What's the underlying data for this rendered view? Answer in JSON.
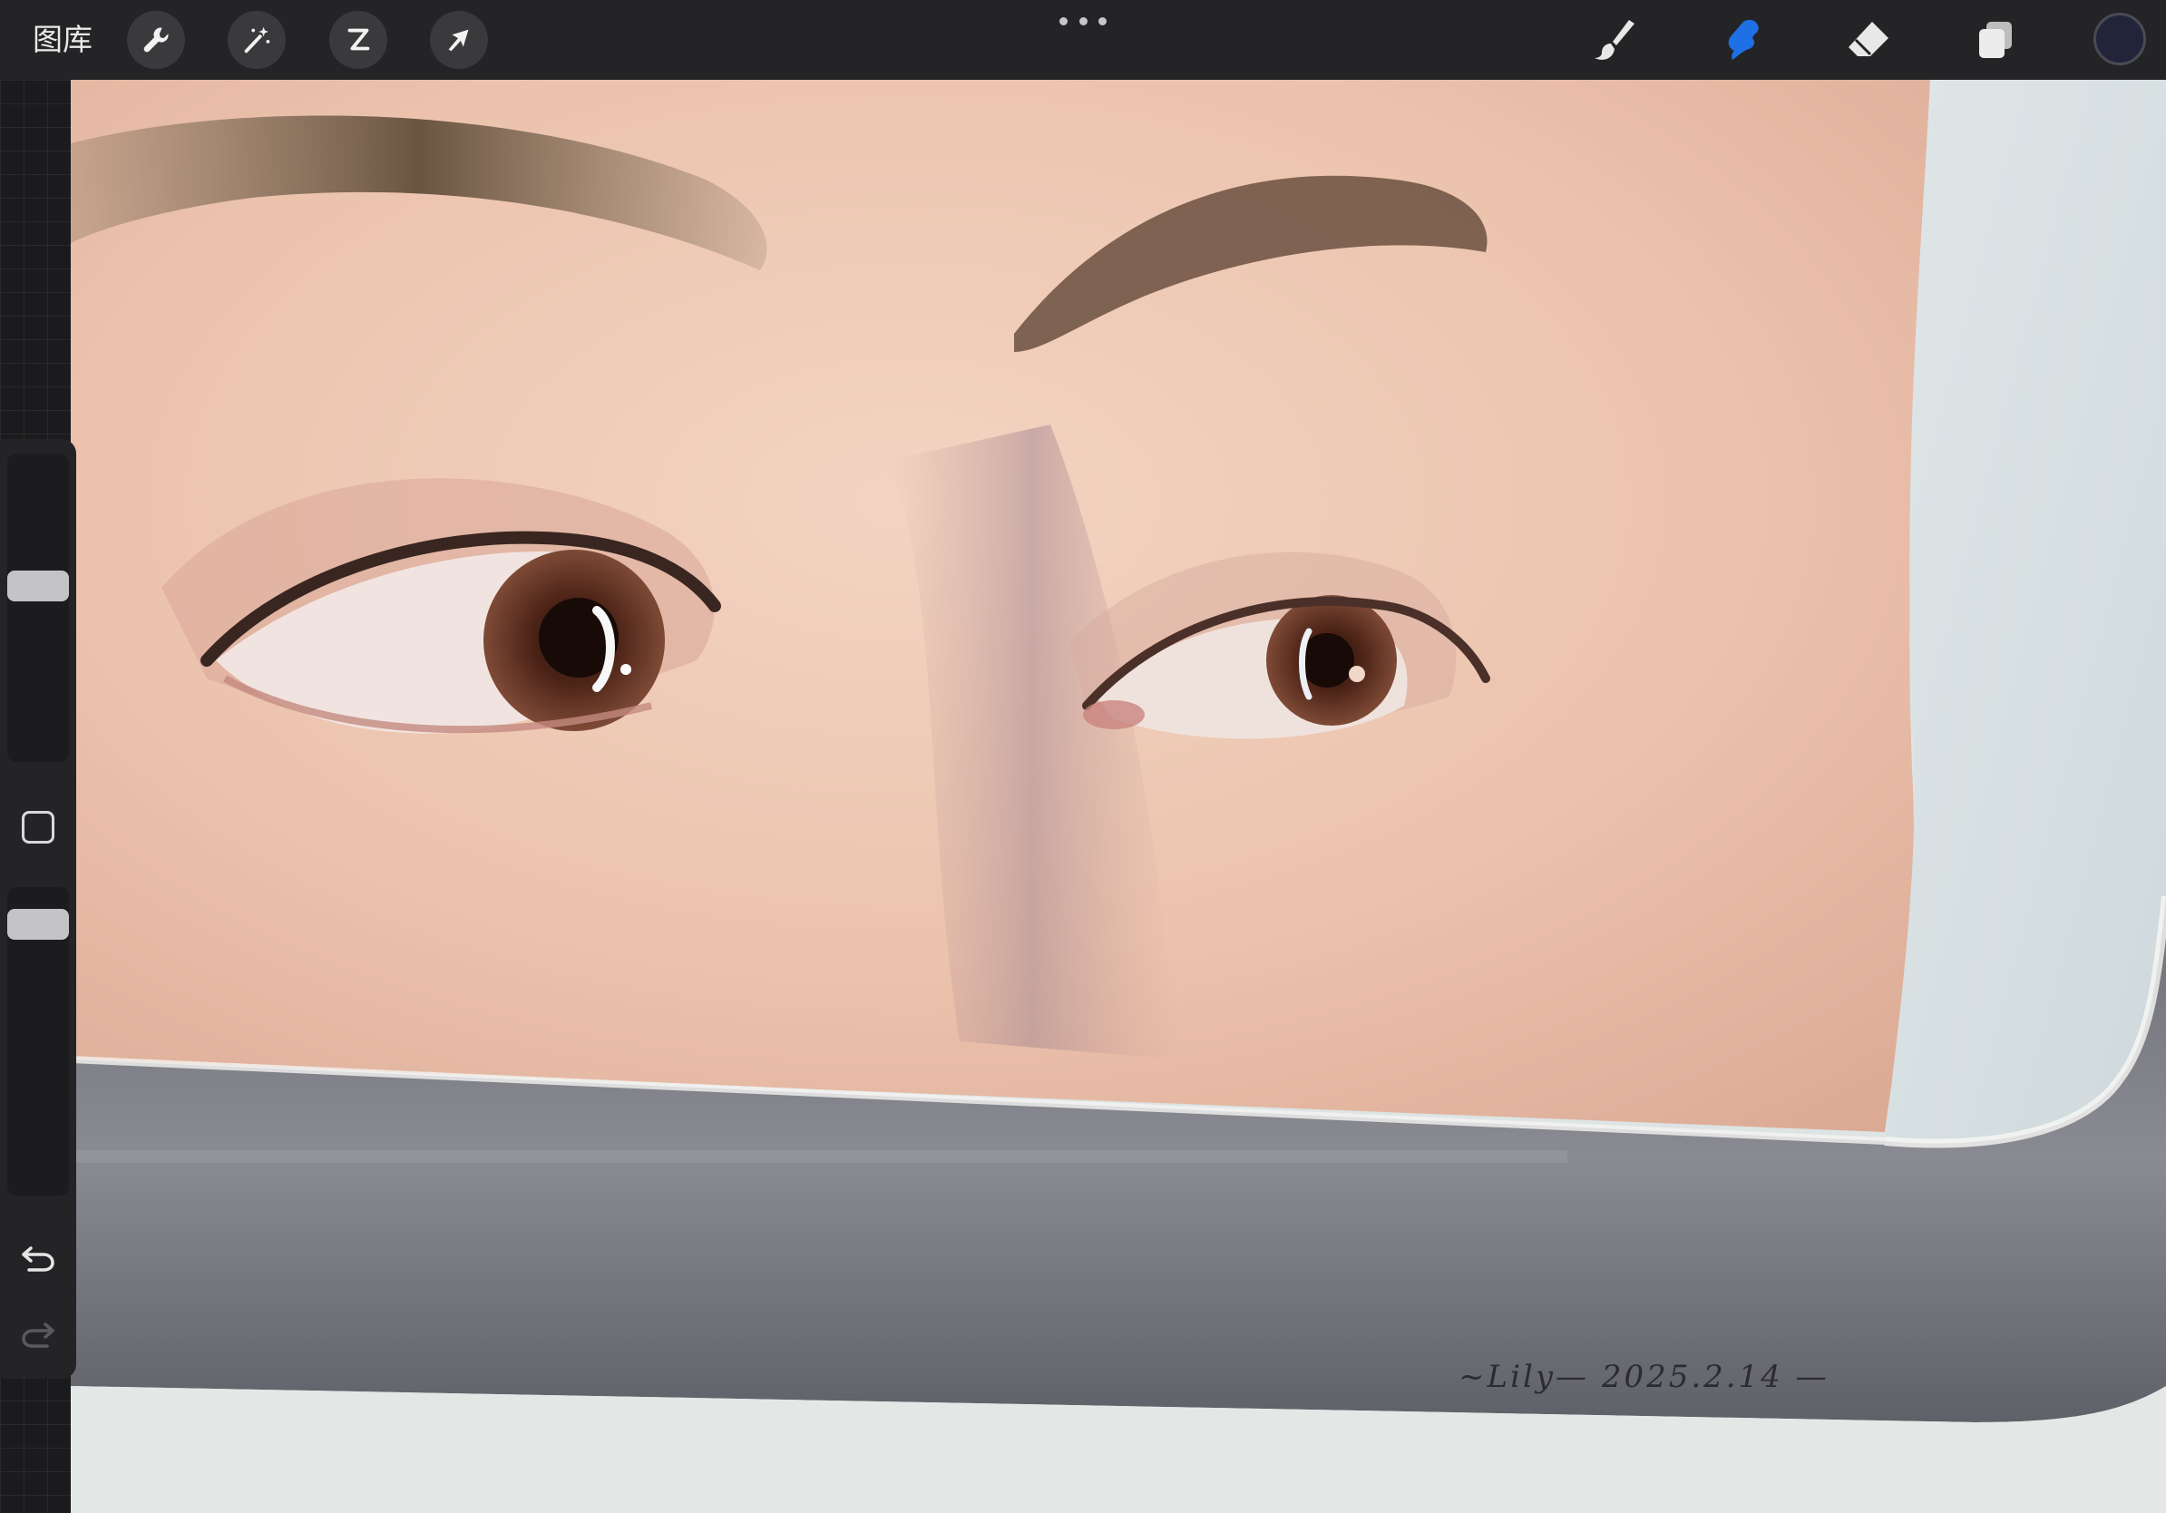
{
  "toolbar": {
    "gallery_label": "图库",
    "left_tools": [
      "wrench-icon",
      "magic-wand-icon",
      "selection-icon",
      "transform-arrow-icon"
    ],
    "right_tools": [
      "brush-icon",
      "smudge-icon",
      "eraser-icon",
      "layers-icon"
    ],
    "active_tool": "smudge",
    "accent_color": "#1f6fe5",
    "current_color": "#22253a"
  },
  "sidebar": {
    "brush_size_level": 0.58,
    "opacity_level": 0.92
  },
  "canvas": {
    "signature": "~Lily— 2025.2.14 —"
  }
}
